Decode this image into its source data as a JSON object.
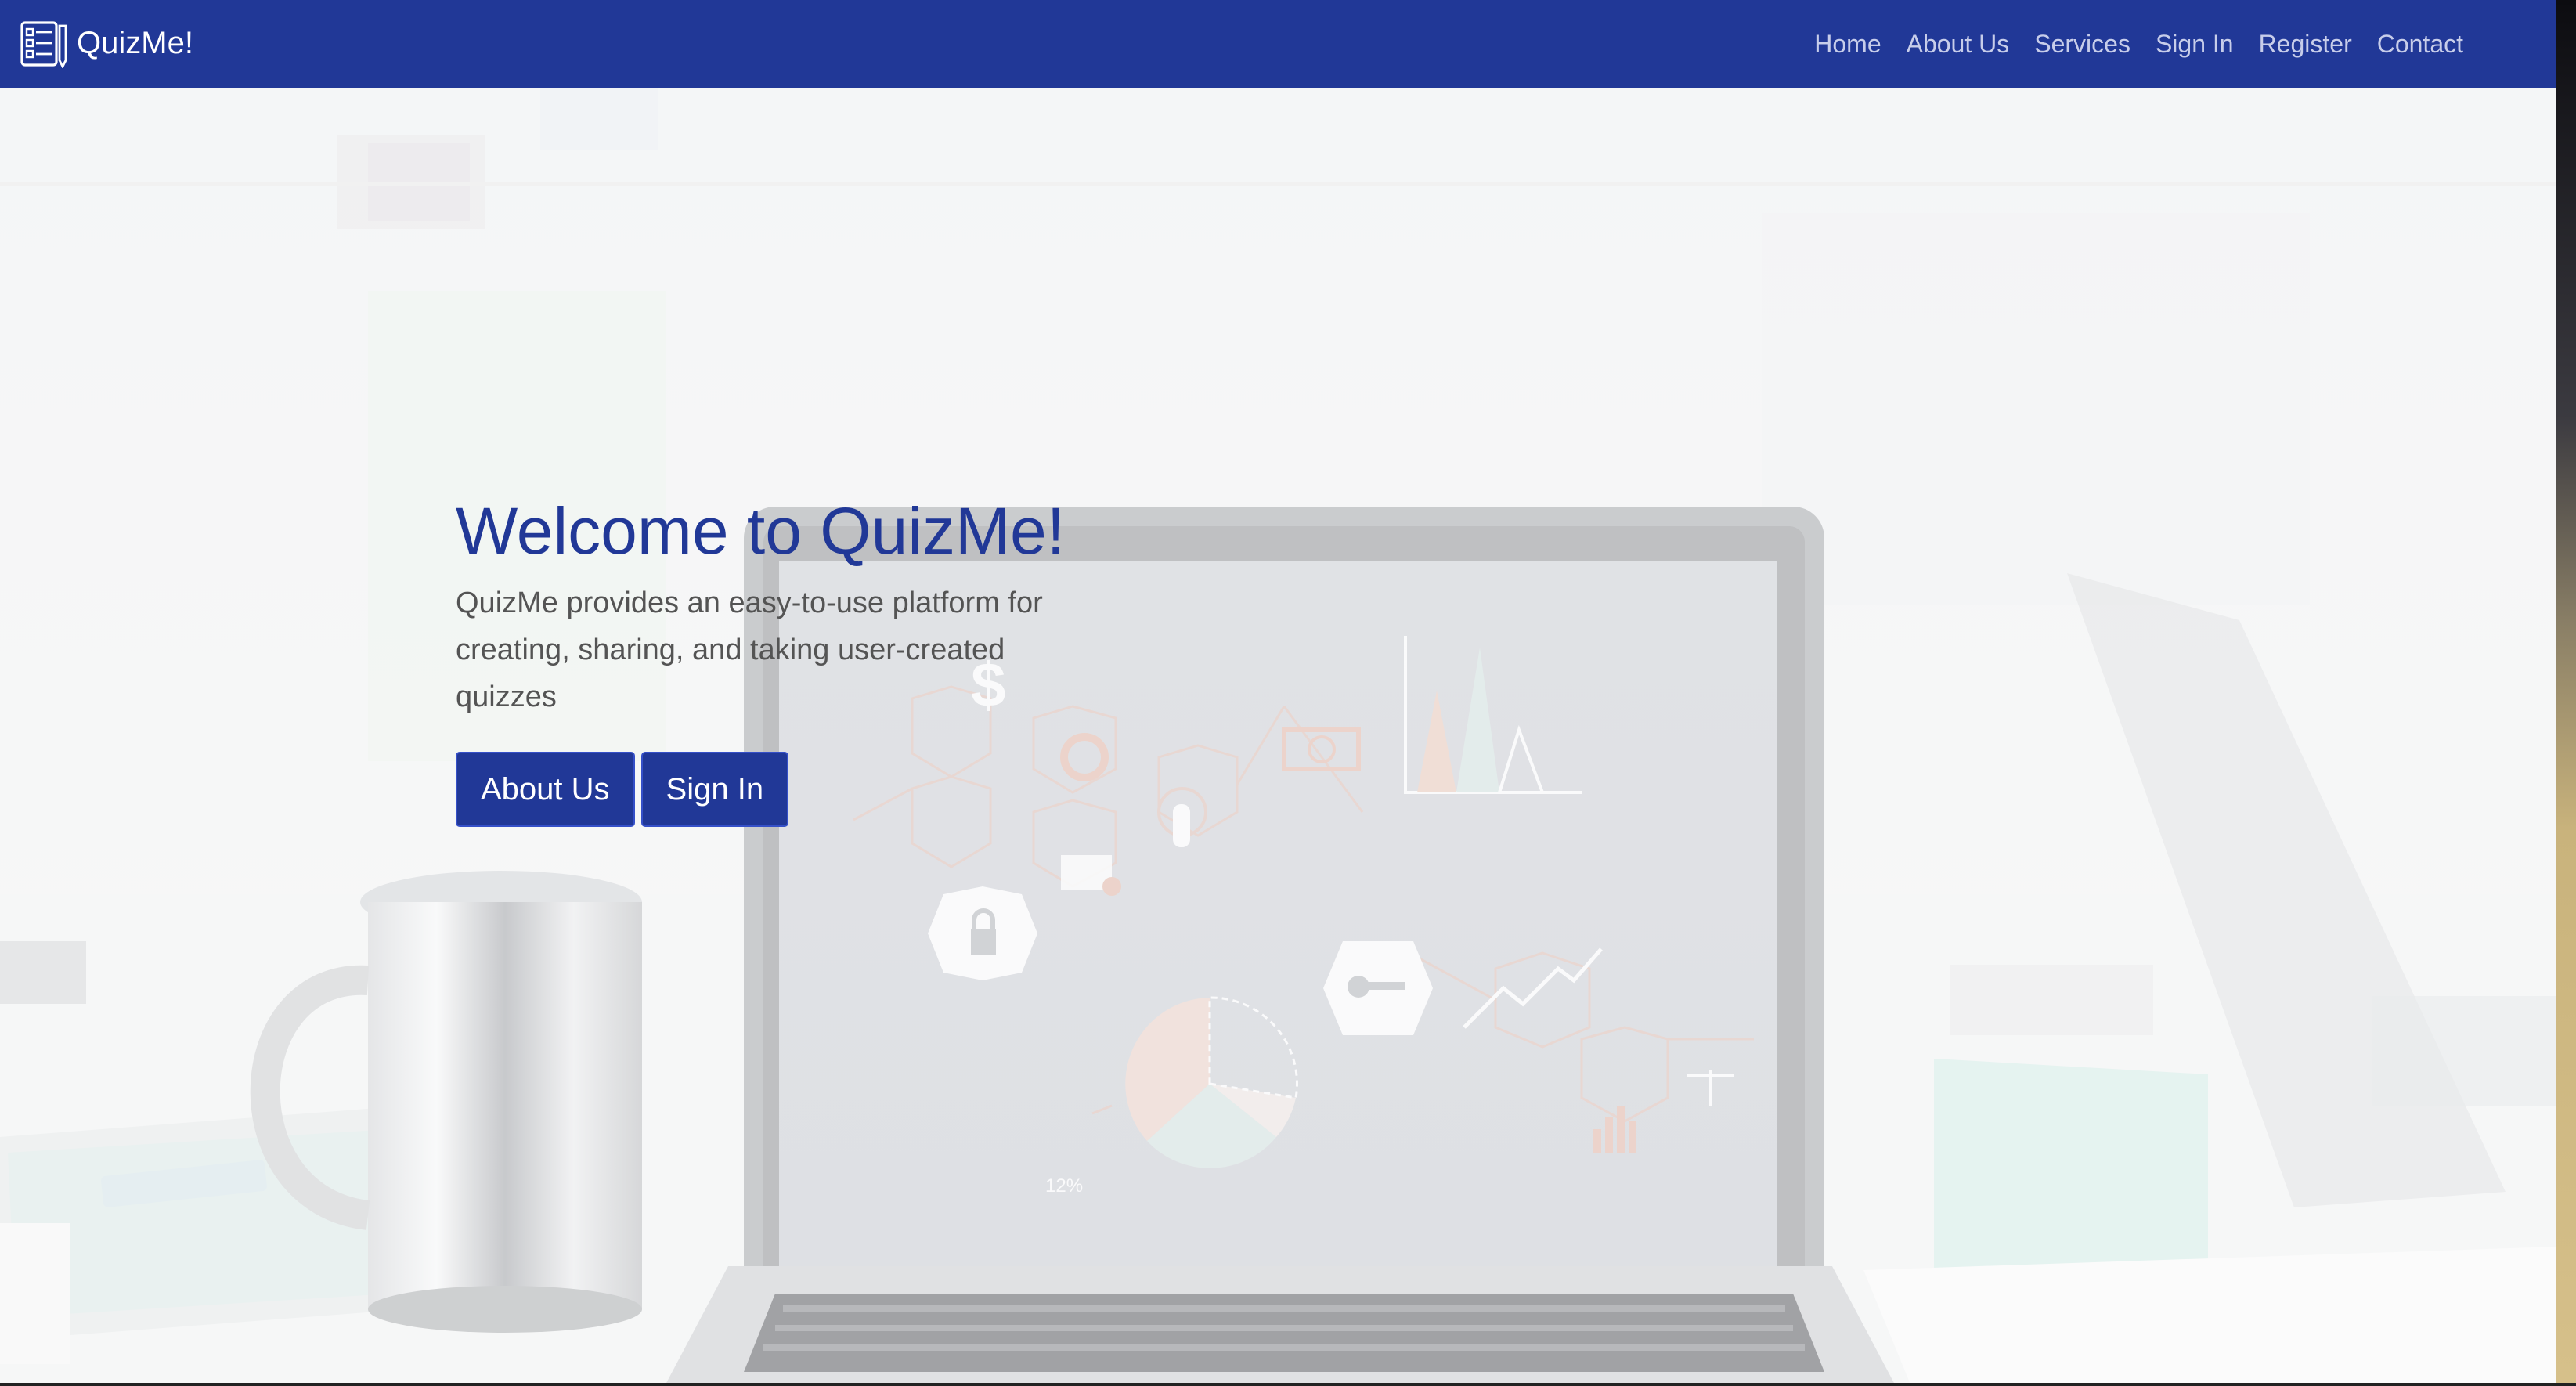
{
  "navbar": {
    "brand": "QuizMe!",
    "links": [
      {
        "label": "Home"
      },
      {
        "label": "About Us"
      },
      {
        "label": "Services"
      },
      {
        "label": "Sign In"
      },
      {
        "label": "Register"
      },
      {
        "label": "Contact"
      }
    ]
  },
  "hero": {
    "title": "Welcome to QuizMe!",
    "description": "QuizMe provides an easy-to-use platform for creating, sharing, and taking user-created quizzes",
    "buttons": {
      "about_label": "About Us",
      "signin_label": "Sign In"
    },
    "background_icons": [
      "laptop",
      "coffee-mug",
      "dollar-icon",
      "refresh-icon",
      "lock-icon",
      "key-icon",
      "pie-chart",
      "bar-chart",
      "scale-icon",
      "trend-line-icon"
    ],
    "screen_label": "12%"
  },
  "colors": {
    "navbar_bg": "#213897",
    "nav_link": "#c7cdea",
    "title": "#213897",
    "button_bg": "#213897",
    "text": "#545454"
  }
}
